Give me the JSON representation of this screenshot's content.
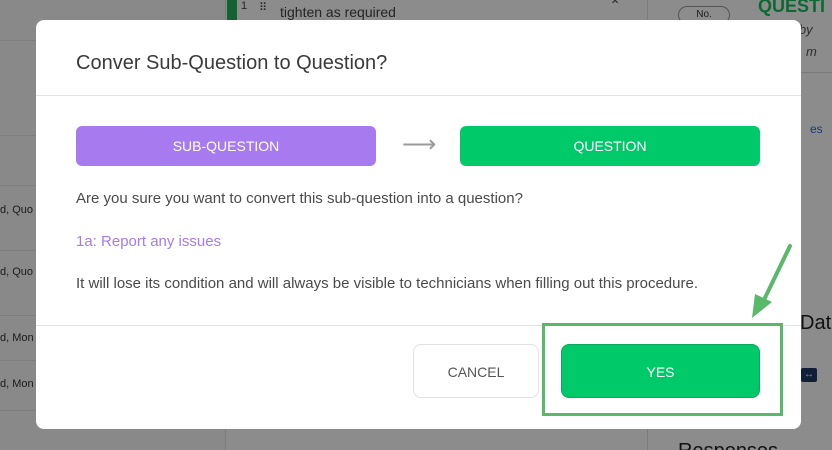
{
  "background": {
    "top_item": {
      "number": "1",
      "text": "tighten as required"
    },
    "left_rows": [
      "d, Quo",
      "d, Quo",
      "d, Mon",
      "d, Mon"
    ],
    "right_panel": {
      "badge": "No.",
      "heading": "QUESTI",
      "sub1": "d by",
      "sub2": "m",
      "link": "es",
      "data_title": "Data",
      "responses_title": "Responses"
    }
  },
  "modal": {
    "title": "Conver Sub-Question to Question?",
    "from_label": "SUB-QUESTION",
    "to_label": "QUESTION",
    "question": "Are you sure you want to convert this sub-question into a question?",
    "item": "1a: Report any issues",
    "warning": "It will lose its condition and will always be visible to technicians when filling out this procedure.",
    "cancel_label": "CANCEL",
    "yes_label": "YES"
  },
  "colors": {
    "purple": "#a77af0",
    "green": "#00c96a",
    "annotation_green": "#5ab86a"
  },
  "icons": {
    "arrow": "right-arrow-icon",
    "drag": "drag-handle-icon",
    "caret": "chevron-up-icon"
  }
}
